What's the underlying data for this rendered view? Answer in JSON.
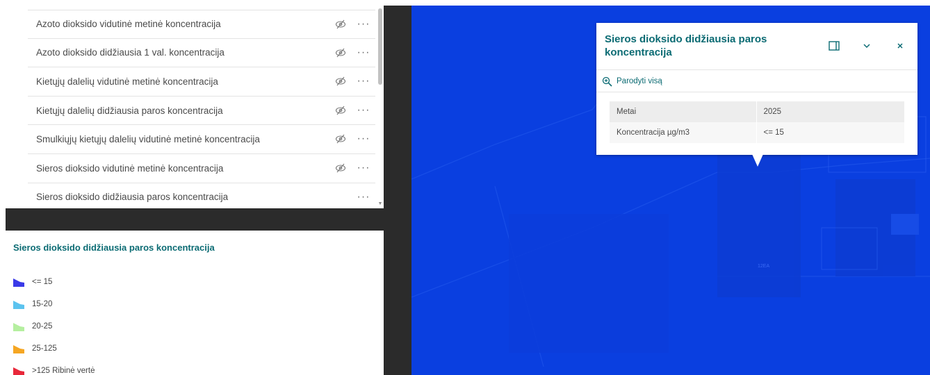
{
  "layers": [
    {
      "label": "Azoto dioksido vidutinė metinė koncentracija",
      "hidden_icon": "eye-off-icon",
      "more": "···"
    },
    {
      "label": "Azoto dioksido didžiausia 1 val. koncentracija",
      "hidden_icon": "eye-off-icon",
      "more": "···"
    },
    {
      "label": "Kietųjų dalelių vidutinė metinė koncentracija",
      "hidden_icon": "eye-off-icon",
      "more": "···"
    },
    {
      "label": "Kietųjų dalelių didžiausia paros koncentracija",
      "hidden_icon": "eye-off-icon",
      "more": "···"
    },
    {
      "label": "Smulkiųjų kietųjų dalelių vidutinė metinė koncentracija",
      "hidden_icon": "eye-off-icon",
      "more": "···"
    },
    {
      "label": "Sieros dioksido vidutinė metinė koncentracija",
      "hidden_icon": "eye-off-icon",
      "more": "···"
    },
    {
      "label": "Sieros dioksido didžiausia paros koncentracija",
      "hidden_icon": "",
      "more": "···"
    }
  ],
  "legend": {
    "title": "Sieros dioksido didžiausia paros koncentracija",
    "items": [
      {
        "label": "<= 15",
        "color": "#3a3ae8"
      },
      {
        "label": "15-20",
        "color": "#5cc3ef"
      },
      {
        "label": "20-25",
        "color": "#b5efa0"
      },
      {
        "label": "25-125",
        "color": "#f5a623"
      },
      {
        "label": ">125 Ribinė vertė",
        "color": "#e8283a"
      }
    ]
  },
  "map": {
    "background": "#0a3fe0",
    "faint_label": "12EA"
  },
  "popup": {
    "title": "Sieros dioksido didžiausia paros koncentracija",
    "dock_icon": "dock-icon",
    "collapse_icon": "chevron-down-icon",
    "close_icon": "close-icon",
    "zoom_label": "Parodyti visą",
    "attributes": [
      {
        "key": "Metai",
        "value": "2025"
      },
      {
        "key": "Koncentracija µg/m3",
        "value": "<= 15"
      }
    ]
  }
}
